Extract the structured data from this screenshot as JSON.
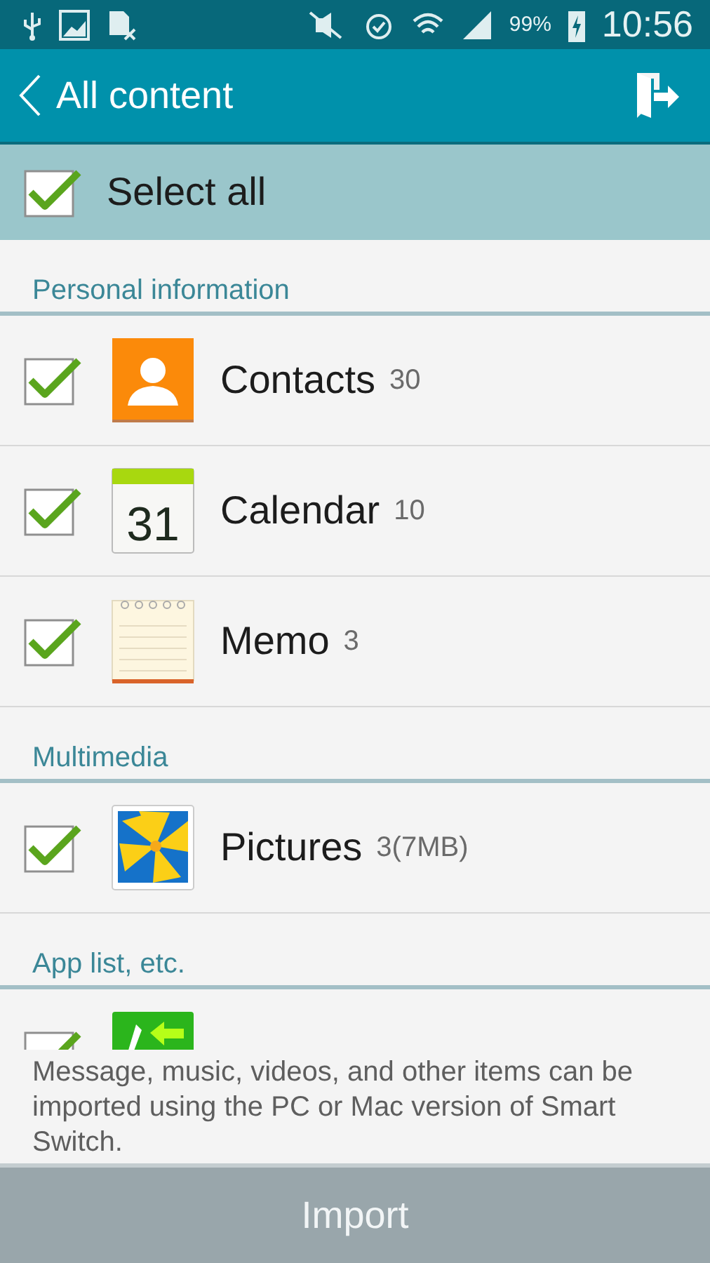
{
  "status_bar": {
    "battery": "99%",
    "time": "10:56"
  },
  "app_bar": {
    "title": "All content"
  },
  "select_all": {
    "label": "Select all",
    "checked": true
  },
  "sections": [
    {
      "title": "Personal information",
      "items": [
        {
          "kind": "contacts",
          "name": "Contacts",
          "count": "30",
          "checked": true
        },
        {
          "kind": "calendar",
          "icon_text": "31",
          "name": "Calendar",
          "count": "10",
          "checked": true
        },
        {
          "kind": "memo",
          "name": "Memo",
          "count": "3",
          "checked": true
        }
      ]
    },
    {
      "title": "Multimedia",
      "items": [
        {
          "kind": "pictures",
          "name": "Pictures",
          "count": "3(7MB)",
          "checked": true
        }
      ]
    },
    {
      "title": "App list, etc.",
      "items": [
        {
          "kind": "call_log",
          "checked": true
        }
      ]
    }
  ],
  "note": "Message, music, videos, and other items can be imported using the PC or Mac version of Smart Switch.",
  "import_button": "Import"
}
